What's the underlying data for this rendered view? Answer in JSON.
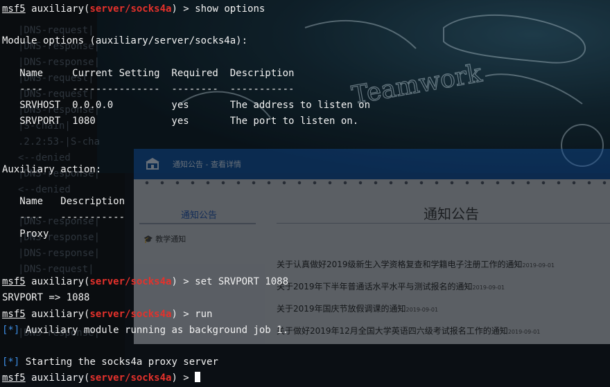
{
  "terminal": {
    "prompt_prefix": "msf5",
    "prompt_pre_module": " auxiliary(",
    "prompt_module": "server/socks4a",
    "prompt_post_module": ") > ",
    "cmd1": "show options",
    "module_options_header": "Module options (auxiliary/server/socks4a):",
    "options_columns": "   Name     Current Setting  Required  Description",
    "options_underline": "   ----     ---------------  --------  -----------",
    "options_rows": [
      "   SRVHOST  0.0.0.0          yes       The address to listen on",
      "   SRVPORT  1080             yes       The port to listen on."
    ],
    "action_header": "Auxiliary action:",
    "action_columns": "   Name   Description",
    "action_underline": "   ----   -----------",
    "action_row": "   Proxy",
    "cmd2": "set SRVPORT 1088",
    "srvport_result": "SRVPORT => 1088",
    "cmd3": "run",
    "status_marker": "[*]",
    "status1": " Auxiliary module running as background job 1.",
    "status2": " Starting the socks4a proxy server"
  },
  "ghost_text": [
    "|DNS-request|",
    "|DNS-response|",
    "|DNS-response|",
    "|DNS-request|",
    "|DNS-request|",
    "|DNS-response|",
    "|S-chain|",
    ".2.2:53-|S-cha",
    "<--denied",
    "|DNS-response|",
    "<--denied",
    "|DNS-response|",
    "|DNS-response|",
    "|DNS-response|",
    "|DNS-request|",
    "|DNS-response|"
  ],
  "webpage": {
    "breadcrumb": "通知公告 - 查看详情",
    "sidebar_title": "通知公告",
    "sidebar_item": "教学通知",
    "main_title": "通知公告",
    "notices": [
      {
        "title": "关于认真做好2019级新生入学资格复查和学籍电子注册工作的通知",
        "date": "2019-09-01"
      },
      {
        "title": "关于2019年下半年普通话水平水平与测试报名的通知",
        "date": "2019-09-01"
      },
      {
        "title": "关于2019年国庆节放假调课的通知",
        "date": "2019-09-01"
      },
      {
        "title": "关于做好2019年12月全国大学英语四六级考试报名工作的通知",
        "date": "2019-09-01"
      }
    ]
  },
  "whiteboard_text": "Teamwork",
  "colors": {
    "module_red": "#e5312b",
    "status_blue": "#3d8fe6",
    "header_blue": "#0f4f9f"
  }
}
